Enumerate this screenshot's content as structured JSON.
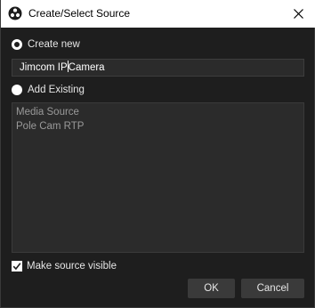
{
  "window": {
    "title": "Create/Select Source",
    "app_icon": "obs-icon",
    "close_icon": "close-icon"
  },
  "create_new": {
    "label": "Create new",
    "selected": true,
    "name_value_before_cursor": "Jimcom IP",
    "name_value_after_cursor": "Camera"
  },
  "add_existing": {
    "label": "Add Existing",
    "selected": false,
    "items": [
      {
        "label": "Media Source"
      },
      {
        "label": "Pole Cam RTP"
      }
    ]
  },
  "make_visible": {
    "label": "Make source visible",
    "checked": true
  },
  "buttons": {
    "ok_label": "OK",
    "cancel_label": "Cancel"
  }
}
